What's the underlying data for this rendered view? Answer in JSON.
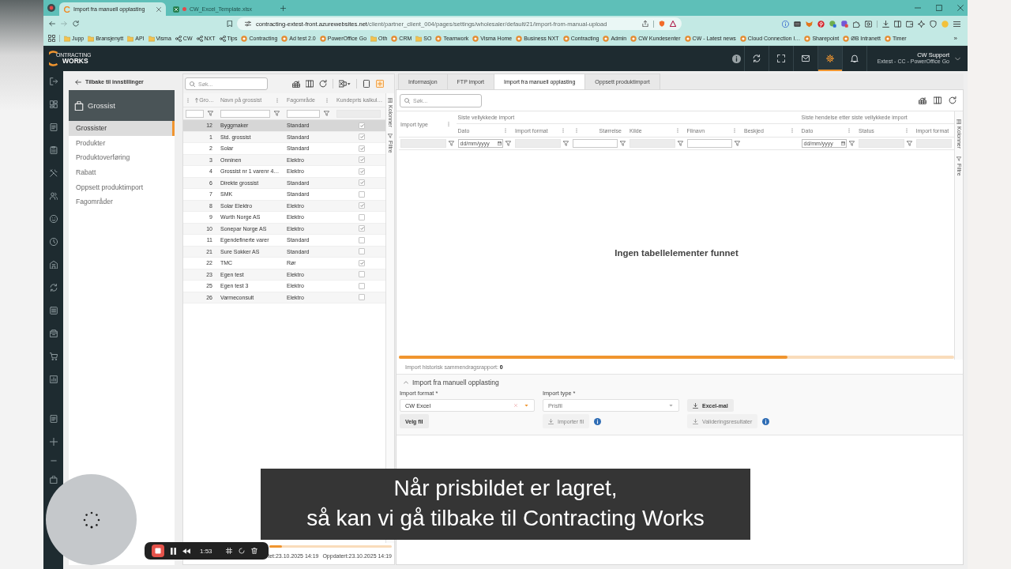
{
  "browser": {
    "tabs": [
      {
        "title": "Import fra manuell opplasting",
        "kind": "web",
        "selected": true
      },
      {
        "title": "CW_Excel_Template.xlsx",
        "kind": "spreadsheet",
        "selected": false
      }
    ],
    "url": {
      "host": "contracting-extest-front.azurewebsites.net",
      "path": "/client/partner_client_004/pages/settings/wholesaler/default/21/import-from-manual-upload"
    },
    "bookmarks": [
      {
        "label": "Jupp",
        "kind": "folder"
      },
      {
        "label": "Bransjenytt",
        "kind": "folder"
      },
      {
        "label": "API",
        "kind": "folder"
      },
      {
        "label": "Visma",
        "kind": "folder"
      },
      {
        "label": "CW",
        "kind": "link"
      },
      {
        "label": "NXT",
        "kind": "link"
      },
      {
        "label": "Tips",
        "kind": "link"
      },
      {
        "label": "Contracting",
        "kind": "site"
      },
      {
        "label": "Ad test 2.0",
        "kind": "site"
      },
      {
        "label": "PowerOffice Go",
        "kind": "site"
      },
      {
        "label": "Oth",
        "kind": "folder"
      },
      {
        "label": "CRM",
        "kind": "site"
      },
      {
        "label": "SO",
        "kind": "folder"
      },
      {
        "label": "Teamwork",
        "kind": "site"
      },
      {
        "label": "Visma Home",
        "kind": "site"
      },
      {
        "label": "Business NXT",
        "kind": "site"
      },
      {
        "label": "Contracting",
        "kind": "site"
      },
      {
        "label": "Admin",
        "kind": "site"
      },
      {
        "label": "CW Kundesenter",
        "kind": "site"
      },
      {
        "label": "CW - Latest news",
        "kind": "site"
      },
      {
        "label": "Cloud Connection I…",
        "kind": "site"
      },
      {
        "label": "Sharepoint",
        "kind": "site"
      },
      {
        "label": "ØB Intranett",
        "kind": "site"
      },
      {
        "label": "Timer",
        "kind": "site"
      }
    ],
    "bookmarks_more": "»"
  },
  "app": {
    "logo": {
      "line1": "ONTRACTING",
      "line2": "WORKS"
    },
    "header_buttons": [
      {
        "kind": "info",
        "selected": false
      },
      {
        "kind": "sync",
        "selected": false
      },
      {
        "kind": "fullscreen",
        "selected": false
      },
      {
        "kind": "mail",
        "selected": false
      },
      {
        "kind": "settings",
        "selected": true
      },
      {
        "kind": "bell",
        "selected": false
      }
    ],
    "user": {
      "name": "CW Support",
      "company": "Extest - CC - PowerOffice Go"
    }
  },
  "settings_nav": {
    "back": "Tilbake til innstillinger",
    "title": "Grossist",
    "items": [
      {
        "label": "Grossister",
        "selected": true
      },
      {
        "label": "Produkter",
        "selected": false
      },
      {
        "label": "Produktoverføring",
        "selected": false
      },
      {
        "label": "Rabatt",
        "selected": false
      },
      {
        "label": "Oppsett produktimport",
        "selected": false
      },
      {
        "label": "Fagområder",
        "selected": false
      }
    ]
  },
  "wholesalers": {
    "search": {
      "placeholder": "Søk..."
    },
    "columns": [
      {
        "label": "Gro…",
        "kind": "number",
        "sorted": true,
        "menu": true
      },
      {
        "label": "Navn på grossist",
        "kind": "text",
        "sorted": false,
        "menu": true
      },
      {
        "label": "Fagområde",
        "kind": "text",
        "sorted": false,
        "menu": true
      },
      {
        "label": "Kundepris kalkul…",
        "kind": "locked",
        "sorted": false,
        "menu": false
      }
    ],
    "rows": [
      {
        "nr": "12",
        "name": "Byggmaker",
        "area": "Standard",
        "checked": true,
        "selected": true
      },
      {
        "nr": "1",
        "name": "Std. grossist",
        "area": "Standard",
        "checked": true,
        "selected": false
      },
      {
        "nr": "2",
        "name": "Solar",
        "area": "Standard",
        "checked": true,
        "selected": false
      },
      {
        "nr": "3",
        "name": "Onninen",
        "area": "Elektro",
        "checked": true,
        "selected": false
      },
      {
        "nr": "4",
        "name": "Grossist nr 1 varenr 4…",
        "area": "Elektro",
        "checked": true,
        "selected": false
      },
      {
        "nr": "6",
        "name": "Direkte grossist",
        "area": "Standard",
        "checked": true,
        "selected": false
      },
      {
        "nr": "7",
        "name": "SMK",
        "area": "Standard",
        "checked": false,
        "selected": false
      },
      {
        "nr": "8",
        "name": "Solar Elektro",
        "area": "Elektro",
        "checked": true,
        "selected": false
      },
      {
        "nr": "9",
        "name": "Wurth Norge AS",
        "area": "Elektro",
        "checked": false,
        "selected": false
      },
      {
        "nr": "10",
        "name": "Sonepar Norge AS",
        "area": "Elektro",
        "checked": true,
        "selected": false
      },
      {
        "nr": "11",
        "name": "Egendefinerte varer",
        "area": "Standard",
        "checked": false,
        "selected": false
      },
      {
        "nr": "21",
        "name": "Sure Sokker AS",
        "area": "Standard",
        "checked": false,
        "selected": false
      },
      {
        "nr": "22",
        "name": "TMC",
        "area": "Rør",
        "checked": true,
        "selected": false
      },
      {
        "nr": "23",
        "name": "Egen test",
        "area": "Elektro",
        "checked": false,
        "selected": false
      },
      {
        "nr": "25",
        "name": "Egen test 3",
        "area": "Elektro",
        "checked": false,
        "selected": false
      },
      {
        "nr": "26",
        "name": "Varmeconsult",
        "area": "Elektro",
        "checked": false,
        "selected": false
      }
    ],
    "side_tabs": [
      {
        "label": "Kolonner",
        "kind": "columns"
      },
      {
        "label": "Filtre",
        "kind": "filters"
      }
    ],
    "footer": [
      "tet:23.10.2025 14:19",
      "Oppdatert:23.10.2025 14:19"
    ]
  },
  "import_panel": {
    "tabs": [
      {
        "label": "Informasjon",
        "selected": false
      },
      {
        "label": "FTP import",
        "selected": false
      },
      {
        "label": "Import fra manuell opplasting",
        "selected": true
      },
      {
        "label": "Oppsett produktimport",
        "selected": false
      }
    ],
    "search": {
      "placeholder": "Søk..."
    },
    "first_column": {
      "label": "Import type",
      "kind": "locked",
      "menu": true
    },
    "groups": [
      {
        "title": "Siste vellykkede import",
        "columns": [
          {
            "label": "Dato",
            "kind": "date",
            "menu": true,
            "placeholder": "dd/mm/yyyy"
          },
          {
            "label": "Import format",
            "kind": "locked",
            "menu": true
          },
          {
            "label": "Størrelse",
            "kind": "number",
            "menu": true
          },
          {
            "label": "Kilde",
            "kind": "locked",
            "menu": true
          },
          {
            "label": "Filnavn",
            "kind": "text",
            "menu": true
          },
          {
            "label": "Beskjed",
            "kind": "plain",
            "menu": true
          }
        ]
      },
      {
        "title": "Siste hendelse etter siste vellykkede import",
        "columns": [
          {
            "label": "Dato",
            "kind": "date",
            "menu": true,
            "placeholder": "dd/mm/yyyy"
          },
          {
            "label": "Status",
            "kind": "locked",
            "menu": true
          },
          {
            "label": "Import format",
            "kind": "locked",
            "menu": false
          }
        ]
      }
    ],
    "side_tabs": [
      {
        "label": "Kolonner",
        "kind": "columns"
      },
      {
        "label": "Filtre",
        "kind": "filters"
      }
    ],
    "empty_message": "Ingen tabellelementer funnet",
    "summary": "Import historisk sammendragsrapport: **0**",
    "upload_section": {
      "title": "Import fra manuell opplasting",
      "expanded": true,
      "format_field": {
        "label": "Import format *",
        "value": "CW Excel",
        "clearable": true
      },
      "type_field": {
        "label": "Import type *",
        "value": "Prisfil",
        "clearable": false
      },
      "template_button": {
        "label": "Excel-mal",
        "disabled": false
      },
      "choose_button": {
        "label": "Velg fil",
        "disabled": false
      },
      "import_button": {
        "label": "Importer fil",
        "disabled": true
      },
      "validate_button": {
        "label": "Valideringsresultater",
        "disabled": true
      }
    }
  },
  "subtitle": [
    "Når prisbildet er lagret,",
    "så kan vi gå tilbake til Contracting Works"
  ],
  "recorder": {
    "time": "1:53"
  }
}
